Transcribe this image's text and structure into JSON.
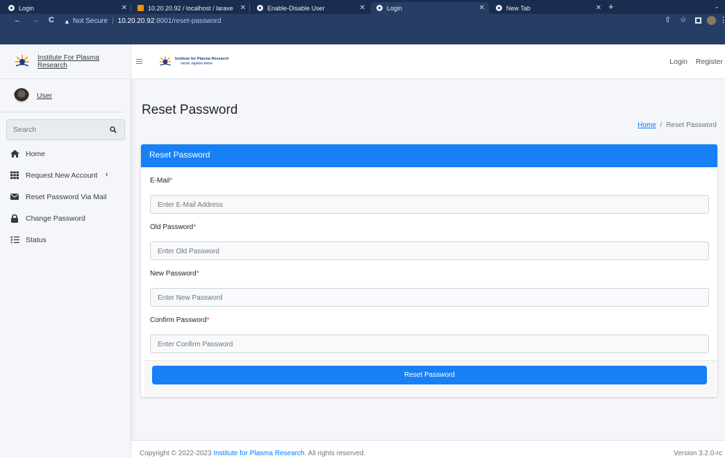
{
  "browser": {
    "tabs": [
      {
        "title": "Login"
      },
      {
        "title": "10.20.20.92 / localhost / larave"
      },
      {
        "title": "Enable-Disable User"
      },
      {
        "title": "Login"
      },
      {
        "title": "New Tab"
      }
    ],
    "new_tab": "+",
    "tab_menu": "⌄",
    "security": "Not Secure",
    "url_host": "10.20.20.92",
    "url_path": ":8001/reset-password"
  },
  "sidebar": {
    "brand": "Institute For Plasma Research",
    "user": "User",
    "search_placeholder": "Search",
    "items": [
      {
        "label": "Home",
        "icon": "home-icon"
      },
      {
        "label": "Request New Account",
        "icon": "grid-icon",
        "chevron": "‹"
      },
      {
        "label": "Reset Password Via Mail",
        "icon": "envelope-icon"
      },
      {
        "label": "Change Password",
        "icon": "lock-icon"
      },
      {
        "label": "Status",
        "icon": "list-check-icon"
      }
    ]
  },
  "topnav": {
    "logo_line1": "Institute for Plasma Research",
    "logo_line2": "प्लाज़्मा अनुसंधान संस्थान",
    "login": "Login",
    "register": "Register"
  },
  "page": {
    "title": "Reset Password",
    "breadcrumb_home": "Home",
    "breadcrumb_sep": "/",
    "breadcrumb_current": "Reset Password"
  },
  "form": {
    "header": "Reset Password",
    "fields": [
      {
        "label": "E-Mail",
        "placeholder": "Enter E-Mail Address"
      },
      {
        "label": "Old Password",
        "placeholder": "Enter Old Password"
      },
      {
        "label": "New Password",
        "placeholder": "Enter New Password"
      },
      {
        "label": "Confirm Password",
        "placeholder": "Enter Confirm Password"
      }
    ],
    "required_mark": "*",
    "submit": "Reset Password"
  },
  "footer": {
    "copyright_prefix": "Copyright © 2022-2023",
    "org_link": "Institute for Plasma Research",
    "copyright_suffix": ". All rights reserved.",
    "version": "Version 3.2.0-rc"
  },
  "colors": {
    "primary": "#1780f5",
    "tab_bar": "#1a2d4f",
    "toolbar": "#263d66",
    "required": "#dc3545"
  }
}
